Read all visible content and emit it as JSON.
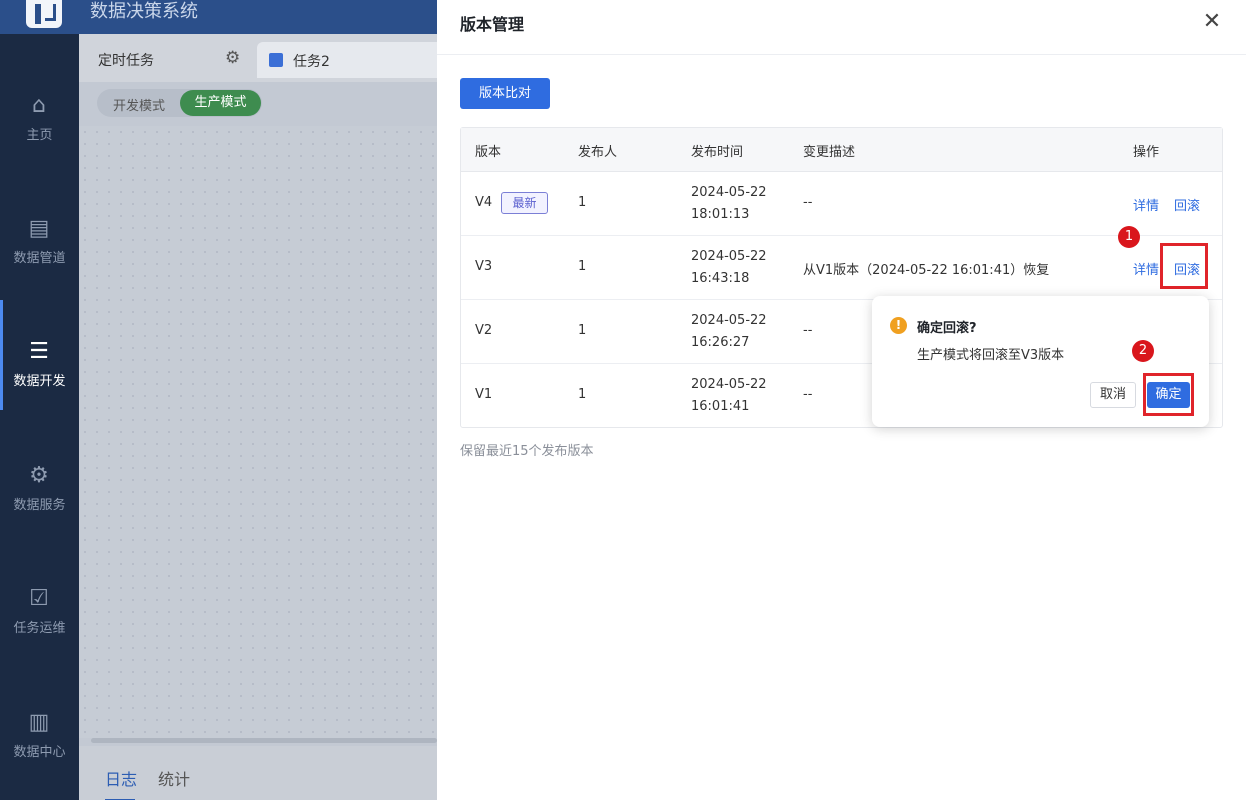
{
  "app": {
    "title": "数据决策系统"
  },
  "sidebar": {
    "items": [
      {
        "label": "主页",
        "icon": "home-icon"
      },
      {
        "label": "数据管道",
        "icon": "pipeline-icon"
      },
      {
        "label": "数据开发",
        "icon": "dev-icon",
        "active": true
      },
      {
        "label": "数据服务",
        "icon": "service-icon"
      },
      {
        "label": "任务运维",
        "icon": "ops-icon"
      },
      {
        "label": "数据中心",
        "icon": "center-icon"
      }
    ]
  },
  "main": {
    "tab_scheduled": "定时任务",
    "tab_task": "任务2",
    "mode_dev": "开发模式",
    "mode_prod": "生产模式",
    "bottom_tabs": [
      "日志",
      "统计"
    ]
  },
  "drawer": {
    "title": "版本管理",
    "compare_button": "版本比对",
    "columns": [
      "版本",
      "发布人",
      "发布时间",
      "变更描述",
      "操作"
    ],
    "rows": [
      {
        "version": "V4",
        "badge": "最新",
        "publisher": "1",
        "date": "2024-05-22",
        "time": "18:01:13",
        "desc": "--",
        "detail": "详情",
        "rollback": "回滚"
      },
      {
        "version": "V3",
        "publisher": "1",
        "date": "2024-05-22",
        "time": "16:43:18",
        "desc": "从V1版本（2024-05-22 16:01:41）恢复",
        "detail": "详情",
        "rollback": "回滚"
      },
      {
        "version": "V2",
        "publisher": "1",
        "date": "2024-05-22",
        "time": "16:26:27",
        "desc": "--"
      },
      {
        "version": "V1",
        "publisher": "1",
        "date": "2024-05-22",
        "time": "16:01:41",
        "desc": "--"
      }
    ],
    "footnote": "保留最近15个发布版本"
  },
  "popconfirm": {
    "title": "确定回滚?",
    "message": "生产模式将回滚至V3版本",
    "cancel": "取消",
    "ok": "确定"
  },
  "markers": [
    "1",
    "2"
  ],
  "colors": {
    "primary": "#2f6ce0",
    "highlight": "#e0242a",
    "warning": "#f0a020",
    "prod_mode": "#3e8c4f"
  }
}
